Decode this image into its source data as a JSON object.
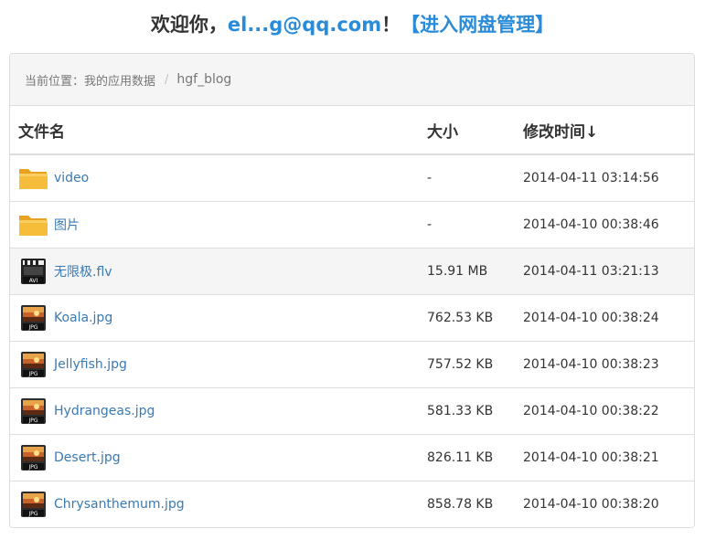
{
  "header": {
    "prefix": "欢迎你，",
    "email": "el...g@qq.com",
    "suffix": "！",
    "manage_link": "【进入网盘管理】"
  },
  "breadcrumb": {
    "label": "当前位置：我的应用数据",
    "separator": "/",
    "current": "hgf_blog"
  },
  "table": {
    "columns": [
      "文件名",
      "大小",
      "修改时间↓"
    ],
    "rows": [
      {
        "icon": "folder-icon",
        "name": "video",
        "size": "-",
        "modified": "2014-04-11 03:14:56"
      },
      {
        "icon": "folder-icon",
        "name": "图片",
        "size": "-",
        "modified": "2014-04-10 00:38:46"
      },
      {
        "icon": "avi-file-icon",
        "name": "无限极.flv",
        "size": "15.91 MB",
        "modified": "2014-04-11 03:21:13"
      },
      {
        "icon": "jpg-file-icon",
        "name": "Koala.jpg",
        "size": "762.53 KB",
        "modified": "2014-04-10 00:38:24"
      },
      {
        "icon": "jpg-file-icon",
        "name": "Jellyfish.jpg",
        "size": "757.52 KB",
        "modified": "2014-04-10 00:38:23"
      },
      {
        "icon": "jpg-file-icon",
        "name": "Hydrangeas.jpg",
        "size": "581.33 KB",
        "modified": "2014-04-10 00:38:22"
      },
      {
        "icon": "jpg-file-icon",
        "name": "Desert.jpg",
        "size": "826.11 KB",
        "modified": "2014-04-10 00:38:21"
      },
      {
        "icon": "jpg-file-icon",
        "name": "Chrysanthemum.jpg",
        "size": "858.78 KB",
        "modified": "2014-04-10 00:38:20"
      }
    ]
  },
  "colors": {
    "link": "#3a7ab5",
    "accent": "#2a8bd8",
    "folder": "#f3b52f",
    "border": "#dddddd",
    "highlight_row": "#f5f5f5"
  }
}
